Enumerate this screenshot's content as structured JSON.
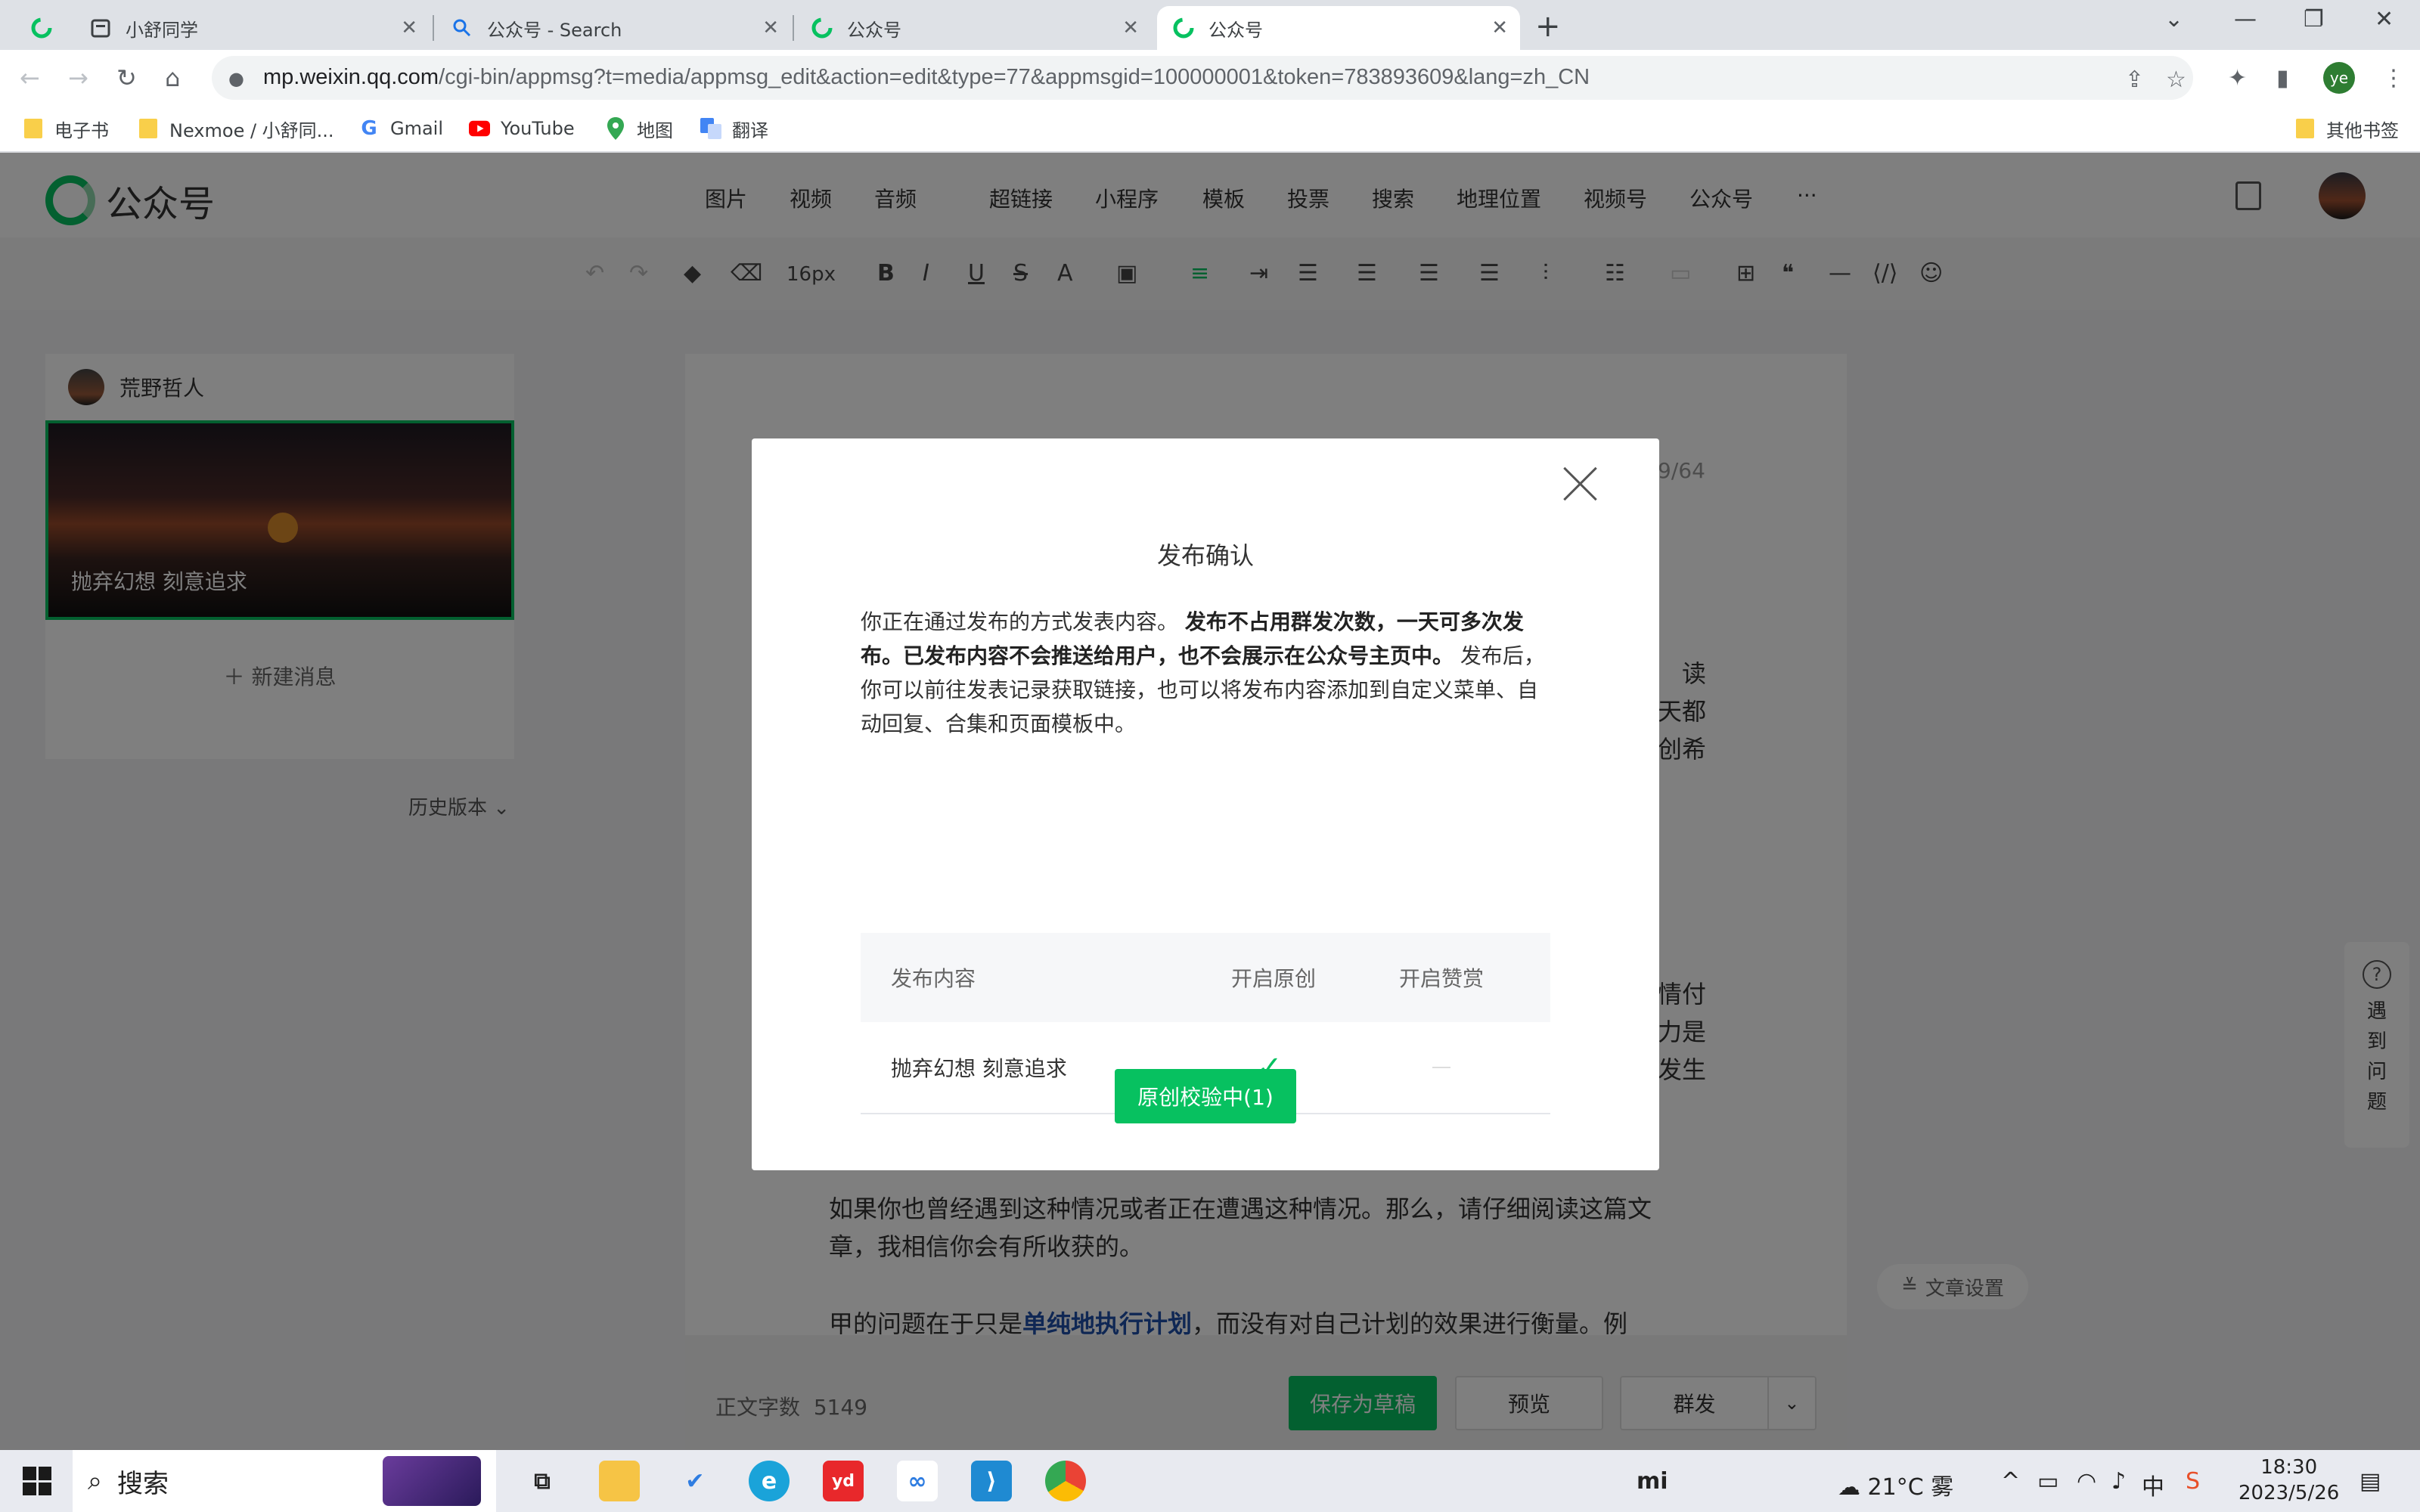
{
  "browser": {
    "tabs": [
      {
        "title": "小舒同学",
        "icon": "calendar-icon"
      },
      {
        "title": "公众号 - Search",
        "icon": "search-icon"
      },
      {
        "title": "公众号",
        "icon": "wechat-mp-icon"
      },
      {
        "title": "公众号",
        "icon": "wechat-mp-icon",
        "active": true
      }
    ],
    "url_host": "mp.weixin.qq.com",
    "url_path": "/cgi-bin/appmsg?t=media/appmsg_edit&action=edit&type=77&appmsgid=100000001&token=783893609&lang=zh_CN",
    "profile_initials": "ye",
    "bookmarks": [
      {
        "label": "电子书",
        "icon": "folder-icon"
      },
      {
        "label": "Nexmoe / 小舒同...",
        "icon": "folder-icon"
      },
      {
        "label": "Gmail",
        "icon": "google-icon"
      },
      {
        "label": "YouTube",
        "icon": "youtube-icon"
      },
      {
        "label": "地图",
        "icon": "maps-pin-icon"
      },
      {
        "label": "翻译",
        "icon": "translate-icon"
      }
    ],
    "other_bookmarks": "其他书签"
  },
  "mp": {
    "logo_text": "公众号",
    "menu": [
      "图片",
      "视频",
      "音频",
      "超链接",
      "小程序",
      "模板",
      "投票",
      "搜索",
      "地理位置",
      "视频号",
      "公众号",
      "···"
    ],
    "font_size": "16px",
    "account_name": "荒野哲人",
    "article_title": "抛弃幻想 刻意追求",
    "new_message": "新建消息",
    "history": "历史版本",
    "title_counter": "9/64",
    "body_fragments": [
      "读",
      "天都",
      "创希",
      "情付",
      "力是",
      "发生"
    ],
    "body_line_1": "如果你也曾经遇到这种情况或者正在遭遇这种情况。那么，请仔细阅读这篇文",
    "body_line_2": "章，我相信你会有所收获的。",
    "body_line_3_pre": "甲的问题在于只是",
    "body_line_3_link": "单纯地执行计划",
    "body_line_3_post": "，而没有对自己计划的效果进行衡量。例",
    "help": "遇到问题",
    "article_settings": "文章设置",
    "word_count_label": "正文字数",
    "word_count": "5149",
    "save_draft": "保存为草稿",
    "preview": "预览",
    "mass_send": "群发"
  },
  "modal": {
    "title": "发布确认",
    "desc_1": "你正在通过发布的方式发表内容。",
    "desc_bold": "发布不占用群发次数，一天可多次发布。已发布内容不会推送给用户，也不会展示在公众号主页中。",
    "desc_2": "发布后，你可以前往发表记录获取链接，也可以将发布内容添加到自定义菜单、自动回复、合集和页面模板中。",
    "table_headers": [
      "发布内容",
      "开启原创",
      "开启赞赏"
    ],
    "row_title": "抛弃幻想 刻意追求",
    "row_original": "✓",
    "button": "原创校验中(1)"
  },
  "taskbar": {
    "search": "搜索",
    "weather": "21°C 雾",
    "ime": "中",
    "time": "18:30",
    "date": "2023/5/26"
  }
}
